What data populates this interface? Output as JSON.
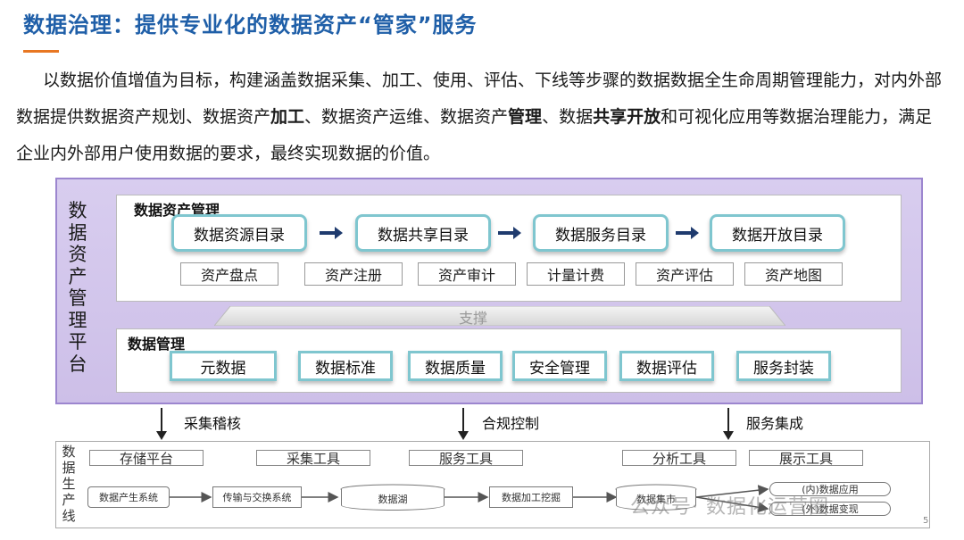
{
  "title": "数据治理：提供专业化的数据资产“管家”服务",
  "intro": {
    "p1": "以数据价值增值为目标，构建涵盖数据采集、加工、使用、评估、下线等步骤的数据数据全生命周期管理能力，对内外部数据提供数据资产规划、数据资产",
    "b1": "加工",
    "p2": "、数据资产运维、数据资产",
    "b2": "管理",
    "p3": "、数据",
    "b3": "共享开放",
    "p4": "和可视化应用等数据治理能力，满足企业内外部用户使用数据的要求，最终实现数据的价值。"
  },
  "platform": {
    "label": "数据资产管理平台",
    "asset_panel": {
      "title": "数据资产管理",
      "catalogs": [
        "数据资源目录",
        "数据共享目录",
        "数据服务目录",
        "数据开放目录"
      ],
      "functions": [
        "资产盘点",
        "资产注册",
        "资产审计",
        "计量计费",
        "资产评估",
        "资产地图"
      ]
    },
    "support_label": "支撑",
    "data_panel": {
      "title": "数据管理",
      "items": [
        "元数据",
        "数据标准",
        "数据质量",
        "安全管理",
        "数据评估",
        "服务封装"
      ]
    }
  },
  "links": [
    "采集稽核",
    "合规控制",
    "服务集成"
  ],
  "production": {
    "label": "数据生产线",
    "tools": [
      "存储平台",
      "采集工具",
      "服务工具",
      "分析工具",
      "展示工具"
    ],
    "nodes": [
      "数据产生系统",
      "传输与交换系统",
      "数据湖",
      "数据加工挖掘",
      "数据集市"
    ],
    "outputs": [
      "(内)数据应用",
      "(外)数据变现"
    ]
  },
  "watermark": "公众号· 数据化运营圈",
  "page_number": "5",
  "colors": {
    "title": "#1f5fa8",
    "accent": "#e87722",
    "platform_bg": "#cdbfe8",
    "box_border": "#7fc6cf",
    "arrow": "#1f3b6e"
  }
}
